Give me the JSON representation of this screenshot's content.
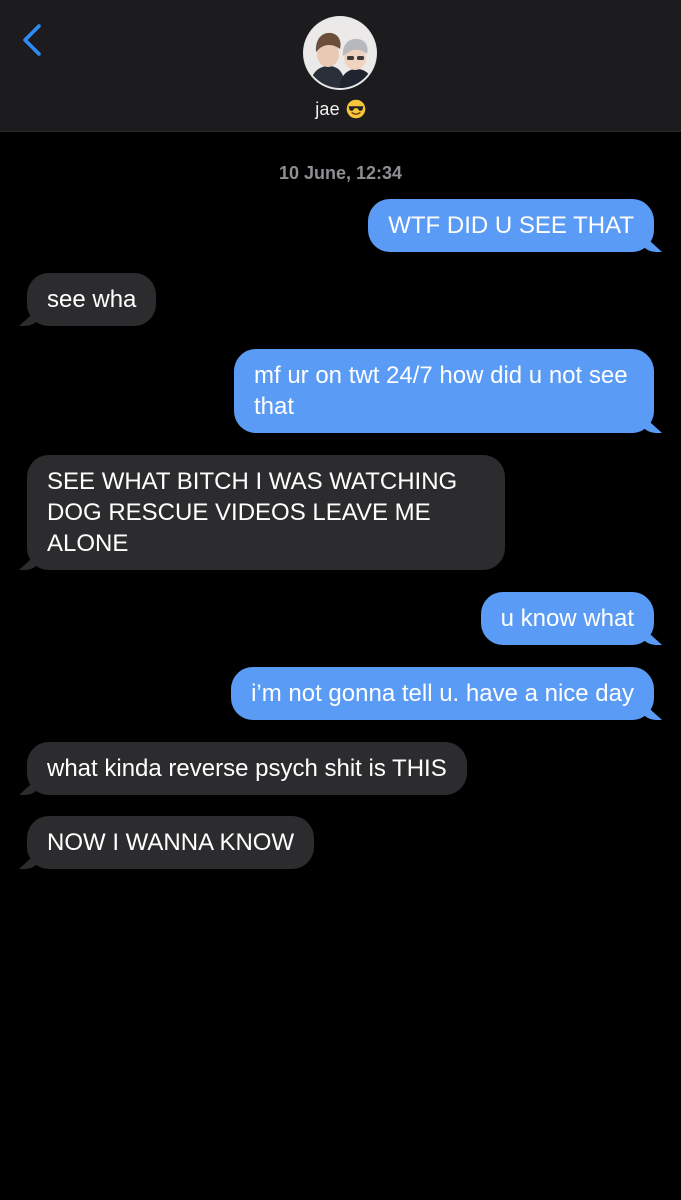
{
  "header": {
    "contact_name": "jae",
    "contact_emoji": "sunglasses-face-emoji",
    "avatar": "contact-avatar-photo",
    "back_icon": "chevron-left-icon",
    "accent_color": "#2f8cf7"
  },
  "conversation": {
    "timestamp": "10 June, 12:34",
    "messages": [
      {
        "direction": "outgoing",
        "text": "WTF DID U SEE THAT"
      },
      {
        "direction": "incoming",
        "text": "see wha"
      },
      {
        "direction": "outgoing",
        "text": "mf ur on twt 24/7 how did u not see that"
      },
      {
        "direction": "incoming",
        "text": "SEE WHAT BITCH I WAS WATCHING DOG RESCUE VIDEOS LEAVE ME ALONE"
      },
      {
        "direction": "outgoing",
        "text": "u know what"
      },
      {
        "direction": "outgoing",
        "text": "i’m not gonna tell u. have a nice day"
      },
      {
        "direction": "incoming",
        "text": "what kinda reverse psych shit is THIS"
      },
      {
        "direction": "incoming",
        "text": "NOW I WANNA KNOW"
      }
    ],
    "colors": {
      "outgoing_bubble": "#5a9bf5",
      "incoming_bubble": "#2c2c2e",
      "background": "#000000",
      "timestamp_text": "#8e8e93"
    }
  }
}
